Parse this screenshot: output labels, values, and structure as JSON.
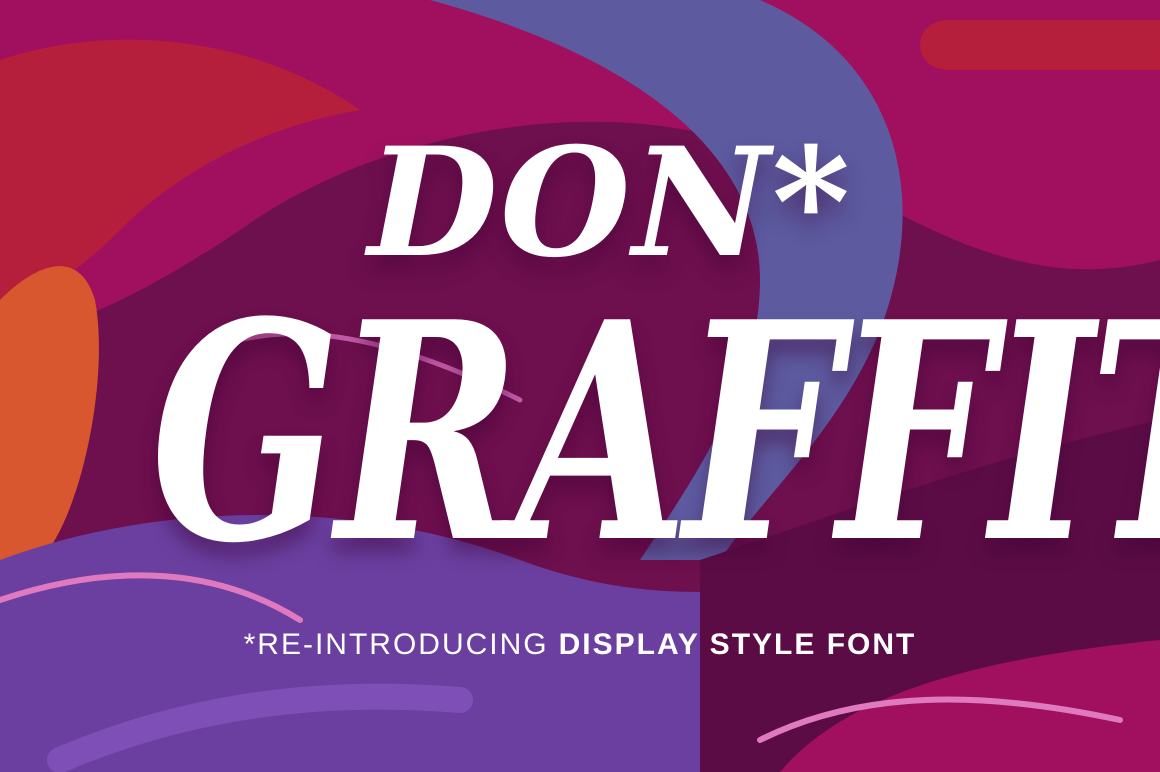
{
  "poster": {
    "title_top": "DON*",
    "title_main": "GRAFFITI",
    "tagline_light": "*RE-INTRODUCING",
    "tagline_bold": "DISPLAY STYLE FONT"
  },
  "colors": {
    "base": "#6e0f4e",
    "magenta": "#a0105f",
    "deep_plum": "#5c0c45",
    "periwinkle": "#5d5aa0",
    "violet": "#6a3fa0",
    "red": "#b51f3c",
    "orange": "#d8572f",
    "pink_stroke": "#e07ac0",
    "text": "#ffffff"
  }
}
